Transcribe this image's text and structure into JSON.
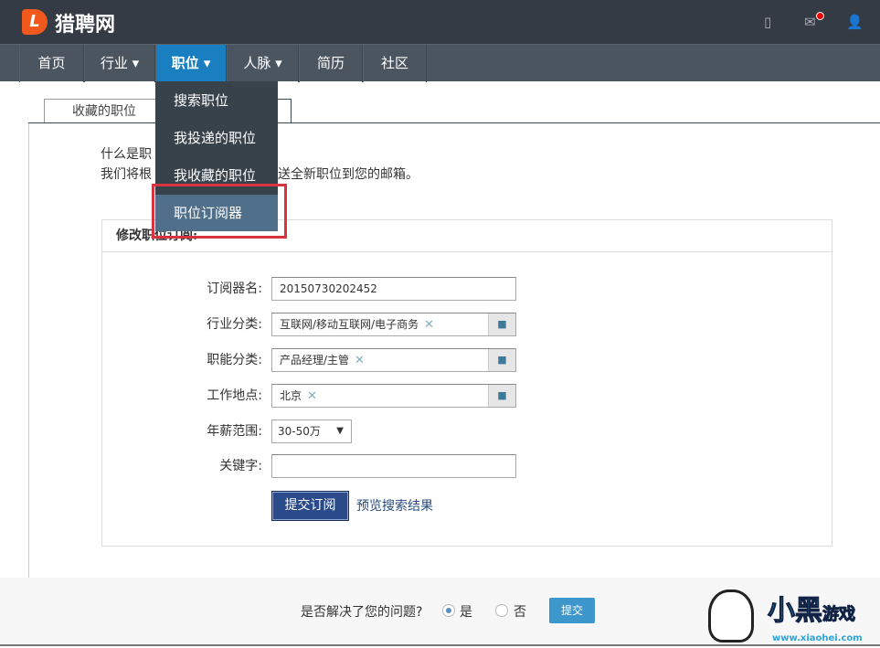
{
  "brand": {
    "name": "猎聘网",
    "logo_letter": "L",
    "accent": "#f0581e"
  },
  "topbar_icons": [
    "tablet-icon",
    "mail-icon",
    "user-icon"
  ],
  "nav": {
    "items": [
      {
        "label": "首页"
      },
      {
        "label": "行业 ▾"
      },
      {
        "label": "职位 ▾"
      },
      {
        "label": "人脉 ▾"
      },
      {
        "label": "简历"
      },
      {
        "label": "社区"
      }
    ],
    "active": "职位"
  },
  "dropdown": {
    "items": [
      "搜索职位",
      "我投递的职位",
      "我收藏的职位",
      "职位订阅器"
    ],
    "highlighted": "职位订阅器"
  },
  "tabs": {
    "tab1": "收藏的职位"
  },
  "intro": {
    "line1_start": "什么是职",
    "line2_start": "我们将根",
    "line2_end": "送全新职位到您的邮箱。"
  },
  "form": {
    "title": "修改职位订阅:",
    "name_label": "订阅器名:",
    "name_value": "20150730202452",
    "industry_label": "行业分类:",
    "industry_value": "互联网/移动互联网/电子商务",
    "function_label": "职能分类:",
    "function_value": "产品经理/主管",
    "location_label": "工作地点:",
    "location_value": "北京",
    "salary_label": "年薪范围:",
    "salary_value": "30-50万",
    "keyword_label": "关键字:",
    "keyword_value": "",
    "submit": "提交订阅",
    "preview": "预览搜索结果"
  },
  "footer": {
    "question": "是否解决了您的问题?",
    "yes": "是",
    "no": "否",
    "selected": "是",
    "submit": "提交"
  },
  "watermark": {
    "text": "小黑游戏",
    "url": "www.xiaohei.com"
  }
}
